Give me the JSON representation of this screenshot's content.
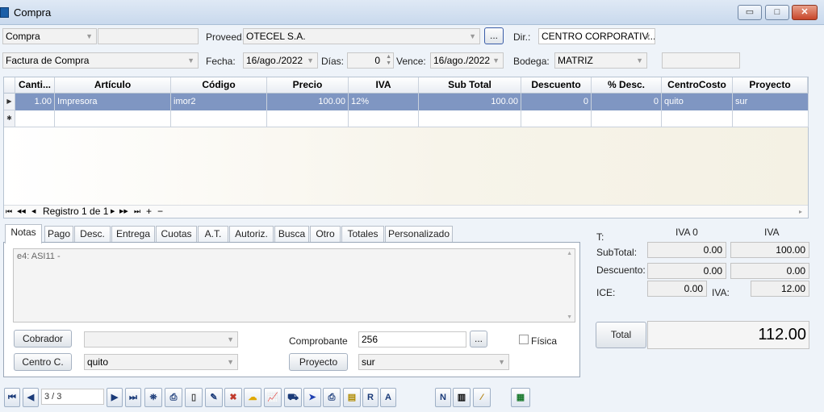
{
  "window": {
    "title": "Compra",
    "min_symbol": "▭",
    "max_symbol": "□",
    "close_symbol": "✕"
  },
  "header": {
    "doc_type": "Compra",
    "doc_extra": "",
    "proveedor_label": "Proveed.",
    "proveedor_value": "OTECEL S.A.",
    "browse_label": "...",
    "dir_label": "Dir.:",
    "dir_value": "CENTRO CORPORATIV...",
    "doc_kind": "Factura de Compra",
    "fecha_label": "Fecha:",
    "fecha_value": "16/ago./2022",
    "dias_label": "Días:",
    "dias_value": "0",
    "vence_label": "Vence:",
    "vence_value": "16/ago./2022",
    "bodega_label": "Bodega:",
    "bodega_value": "MATRIZ",
    "bodega_extra": ""
  },
  "grid": {
    "columns": [
      "Canti...",
      "Artículo",
      "Código",
      "Precio",
      "IVA",
      "Sub Total",
      "Descuento",
      "% Desc.",
      "CentroCosto",
      "Proyecto"
    ],
    "rows": [
      {
        "cantidad": "1.00",
        "articulo": "Impresora",
        "codigo": "imor2",
        "precio": "100.00",
        "iva": "12%",
        "subtotal": "100.00",
        "descuento": "0",
        "pdesc": "0",
        "centrocosto": "quito",
        "proyecto": "sur"
      }
    ],
    "navigator": {
      "text": "Registro 1 de 1",
      "first": "⏮",
      "prevpage": "◀◀",
      "prev": "◀",
      "next": "▶",
      "nextpage": "▶▶",
      "last": "⏭",
      "add": "+",
      "remove": "−"
    }
  },
  "tabs": [
    "Notas",
    "Pago",
    "Desc.",
    "Entrega",
    "Cuotas",
    "A.T.",
    "Autoriz.",
    "Busca",
    "Otro",
    "Totales",
    "Personalizado"
  ],
  "notas": {
    "text": "e4: ASI11 -",
    "cobrador_label": "Cobrador",
    "cobrador_value": "",
    "centro_label": "Centro C.",
    "centro_value": "quito",
    "comprobante_label": "Comprobante",
    "comprobante_value": "256",
    "comprobante_browse": "...",
    "fisica_label": "Física",
    "proyecto_label": "Proyecto",
    "proyecto_value": "sur"
  },
  "totals": {
    "t_label": "T:",
    "iva0_label": "IVA 0",
    "iva_label": "IVA",
    "subtotal_label": "SubTotal:",
    "subtotal_iva0": "0.00",
    "subtotal_iva": "100.00",
    "descuento_label": "Descuento:",
    "descuento_iva0": "0.00",
    "descuento_iva": "0.00",
    "ice_label": "ICE:",
    "ice_value": "0.00",
    "iva_amount_label": "IVA:",
    "iva_amount": "12.00",
    "total_label": "Total",
    "total_value": "112.00"
  },
  "toolbar": {
    "record": "3 / 3",
    "first": "⏮",
    "prev": "◀",
    "next": "▶",
    "last": "⏭",
    "r": "R",
    "a": "A",
    "n": "N"
  },
  "colors": {
    "selection": "#7f96c2",
    "titlebar": "#c9d9ed",
    "close": "#c7462a"
  }
}
